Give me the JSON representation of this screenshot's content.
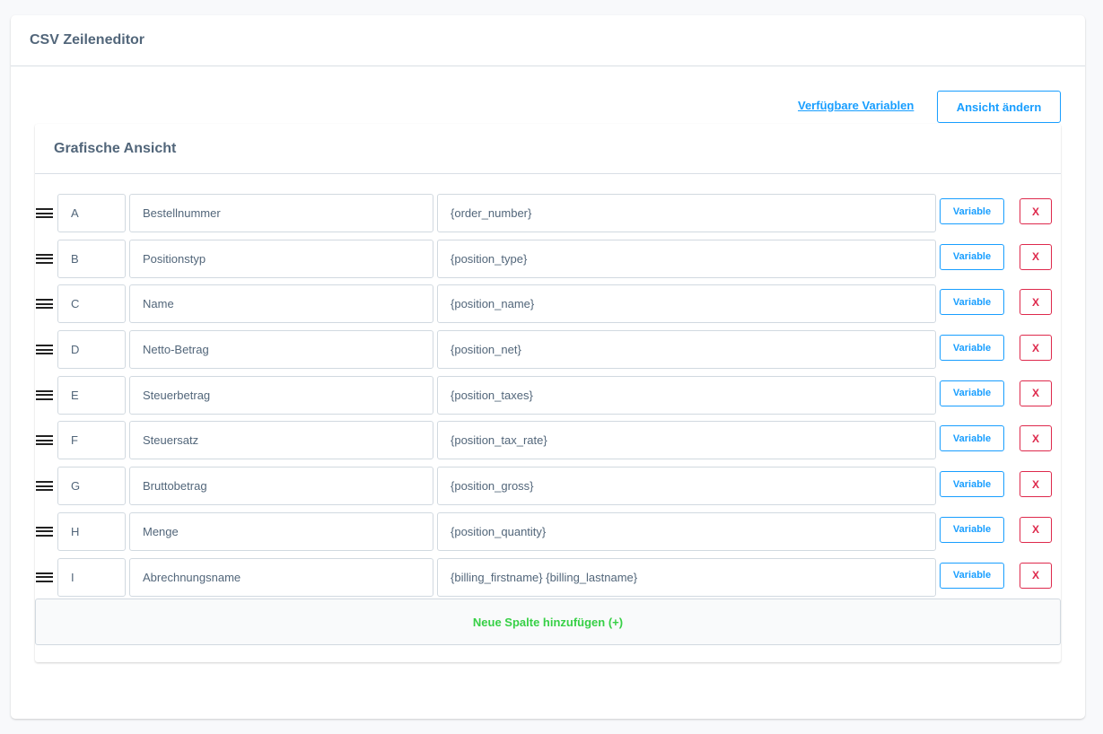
{
  "card": {
    "title": "CSV Zeileneditor"
  },
  "toolbar": {
    "variables_link": "Verfügbare Variablen",
    "change_view_label": "Ansicht ändern"
  },
  "graphic_view": {
    "title": "Grafische Ansicht",
    "rows": [
      {
        "column": "A",
        "name": "Bestellnummer",
        "value": "{order_number}",
        "variable_label": "Variable",
        "delete_label": "X"
      },
      {
        "column": "B",
        "name": "Positionstyp",
        "value": "{position_type}",
        "variable_label": "Variable",
        "delete_label": "X"
      },
      {
        "column": "C",
        "name": "Name",
        "value": "{position_name}",
        "variable_label": "Variable",
        "delete_label": "X"
      },
      {
        "column": "D",
        "name": "Netto-Betrag",
        "value": "{position_net}",
        "variable_label": "Variable",
        "delete_label": "X"
      },
      {
        "column": "E",
        "name": "Steuerbetrag",
        "value": "{position_taxes}",
        "variable_label": "Variable",
        "delete_label": "X"
      },
      {
        "column": "F",
        "name": "Steuersatz",
        "value": "{position_tax_rate}",
        "variable_label": "Variable",
        "delete_label": "X"
      },
      {
        "column": "G",
        "name": "Bruttobetrag",
        "value": "{position_gross}",
        "variable_label": "Variable",
        "delete_label": "X"
      },
      {
        "column": "H",
        "name": "Menge",
        "value": "{position_quantity}",
        "variable_label": "Variable",
        "delete_label": "X"
      },
      {
        "column": "I",
        "name": "Abrechnungsname",
        "value": "{billing_firstname} {billing_lastname}",
        "variable_label": "Variable",
        "delete_label": "X"
      }
    ],
    "add_column_label": "Neue Spalte hinzufügen (+)"
  },
  "icons": {
    "drag_handle": "drag-handle-icon"
  },
  "colors": {
    "accent": "#189eff",
    "danger": "#de294c",
    "success": "#37d046",
    "text": "#52667a"
  }
}
